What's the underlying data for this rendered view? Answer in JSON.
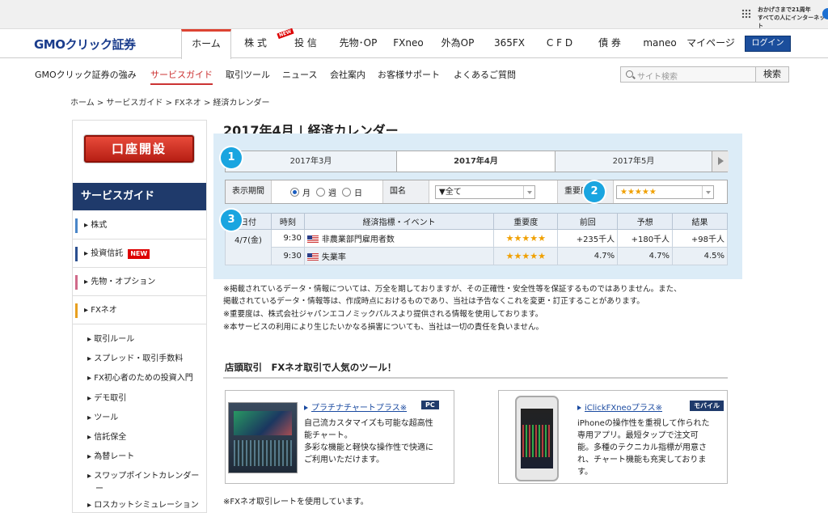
{
  "topbar": {
    "promo_line1": "おかげさまで21周年",
    "promo_line2": "すべての人にインターネット"
  },
  "logo": "GMOクリック証券",
  "gnav": {
    "items": [
      "ホーム",
      "株 式",
      "投 信",
      "先物･OP",
      "FXneo",
      "外為OP",
      "365FX",
      "C F D",
      "債 券",
      "maneo",
      "マイページ"
    ],
    "new_tag": "NEW",
    "login": "ログイン"
  },
  "subnav": {
    "items": [
      "GMOクリック証券の強み",
      "サービスガイド",
      "取引ツール",
      "ニュース",
      "会社案内",
      "お客様サポート",
      "よくあるご質問"
    ],
    "search_placeholder": "サイト検索",
    "search_button": "検索"
  },
  "breadcrumb": "ホーム > サービスガイド > FXネオ > 経済カレンダー",
  "sidebar": {
    "open_account": "口座開設",
    "title": "サービスガイド",
    "items": [
      "株式",
      "投資信託",
      "先物・オプション",
      "FXネオ"
    ],
    "new_badge": "NEW",
    "subitems": [
      "取引ルール",
      "スプレッド・取引手数料",
      "FX初心者のための投資入門",
      "デモ取引",
      "ツール",
      "信託保全",
      "為替レート",
      "スワップポイントカレンダー",
      "ロスカットシミュレーション"
    ]
  },
  "page_title": "2017年4月 | 経済カレンダー",
  "months": [
    "2017年3月",
    "2017年4月",
    "2017年5月"
  ],
  "filter": {
    "period_label": "表示期間",
    "period_options": [
      "月",
      "週",
      "日"
    ],
    "country_label": "国名",
    "country_value": "▼全て",
    "importance_label": "重要度",
    "importance_value": "★★★★★"
  },
  "table": {
    "headers": [
      "日付",
      "時刻",
      "経済指標・イベント",
      "重要度",
      "前回",
      "予想",
      "結果"
    ],
    "rows": [
      {
        "date": "4/7(金)",
        "time": "9:30",
        "event": "非農業部門雇用者数",
        "stars": "★★★★★",
        "prev": "+235千人",
        "forecast": "+180千人",
        "result": "+98千人"
      },
      {
        "date": "",
        "time": "9:30",
        "event": "失業率",
        "stars": "★★★★★",
        "prev": "4.7%",
        "forecast": "4.7%",
        "result": "4.5%"
      }
    ]
  },
  "badges": [
    "1",
    "2",
    "3"
  ],
  "notes": [
    "※掲載されているデータ・情報については、万全を期しておりますが、その正確性・安全性等を保証するものではありません。また、",
    "掲載されているデータ・情報等は、作成時点におけるものであり、当社は予告なくこれを変更・訂正することがあります。",
    "※重要度は、株式会社ジャパンエコノミックパルスより提供される情報を使用しております。",
    "※本サービスの利用により生じたいかなる損害についても、当社は一切の責任を負いません。"
  ],
  "tools_section": {
    "title": "店頭取引　FXネオ取引で人気のツール！",
    "tools": [
      {
        "name": "プラチナチャートプラス※",
        "tag": "PC",
        "desc": [
          "自己流カスタマイズも可能な超高性",
          "能チャート。",
          "多彩な機能と軽快な操作性で快適に",
          "ご利用いただけます。"
        ]
      },
      {
        "name": "iClickFXneoプラス※",
        "tag": "モバイル",
        "desc": [
          "iPhoneの操作性を重視して作られた",
          "専用アプリ。最短タップで注文可",
          "能。多種のテクニカル指標が用意さ",
          "れ、チャート機能も充実しておりま",
          "す。"
        ]
      }
    ]
  },
  "footnote": "※FXネオ取引レートを使用しています。"
}
